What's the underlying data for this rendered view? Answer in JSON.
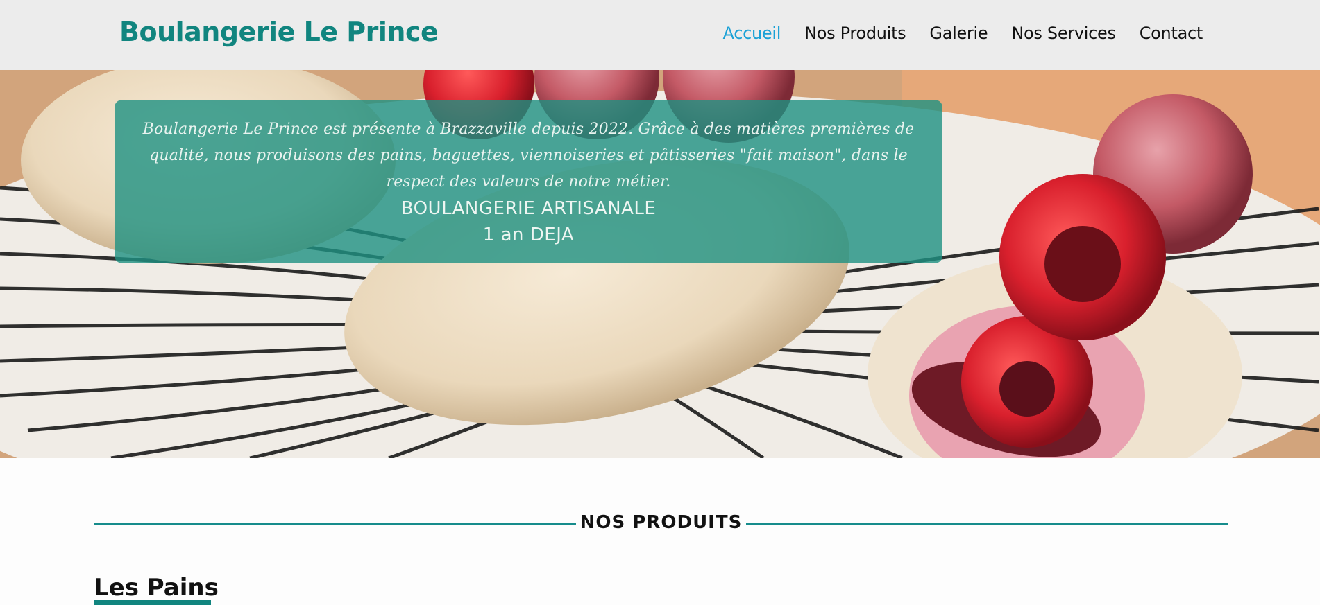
{
  "header": {
    "brand": "Boulangerie Le Prince",
    "nav": [
      {
        "label": "Accueil",
        "active": true
      },
      {
        "label": "Nos Produits",
        "active": false
      },
      {
        "label": "Galerie",
        "active": false
      },
      {
        "label": "Nos Services",
        "active": false
      },
      {
        "label": "Contact",
        "active": false
      }
    ]
  },
  "hero": {
    "line1": "Boulangerie Le Prince est présente à Brazzaville depuis 2022. Grâce à des matières premières de",
    "line2": "qualité, nous produisons des pains, baguettes, viennoiseries et pâtisseries \"fait maison\", dans le",
    "line3": "respect des valeurs de notre métier.",
    "tagline1": "BOULANGERIE ARTISANALE",
    "tagline2": "1 an DEJA"
  },
  "sections": {
    "products_title": "NOS PRODUITS",
    "breads_title": "Les Pains"
  },
  "colors": {
    "brand": "#11857f",
    "nav_active": "#1aa1d6",
    "card": "#1e9182",
    "header_bg": "#ececec"
  }
}
